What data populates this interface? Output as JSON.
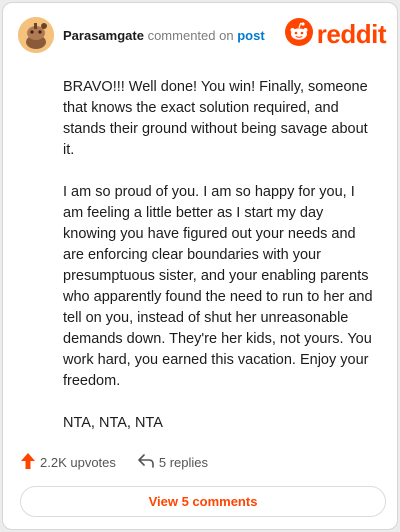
{
  "header": {
    "username": "Parasamgate",
    "action_text": "commented on",
    "post_link": "post",
    "brand": "reddit"
  },
  "comment": {
    "paragraphs": [
      "BRAVO!!! Well done! You win! Finally, someone that knows the exact solution required, and stands their ground without being savage about it.",
      "I am so proud of you. I am so happy for you, I am feeling a little better as I start my day knowing you have figured out your needs and are enforcing clear boundaries with your presumptuous sister, and your enabling parents who apparently found the need to run to her and tell on you, instead of shut her unreasonable demands down. They're her kids, not yours. You work hard, you earned this vacation. Enjoy your freedom.",
      "NTA, NTA, NTA"
    ]
  },
  "actions": {
    "upvotes": "2.2K upvotes",
    "replies": "5 replies"
  },
  "footer": {
    "view_comments": "View 5 comments"
  },
  "colors": {
    "brand": "#ff4500",
    "link": "#0079d3"
  },
  "icons": [
    "avatar",
    "reddit-logo-icon",
    "upvote-arrow-icon",
    "reply-arrow-icon"
  ]
}
